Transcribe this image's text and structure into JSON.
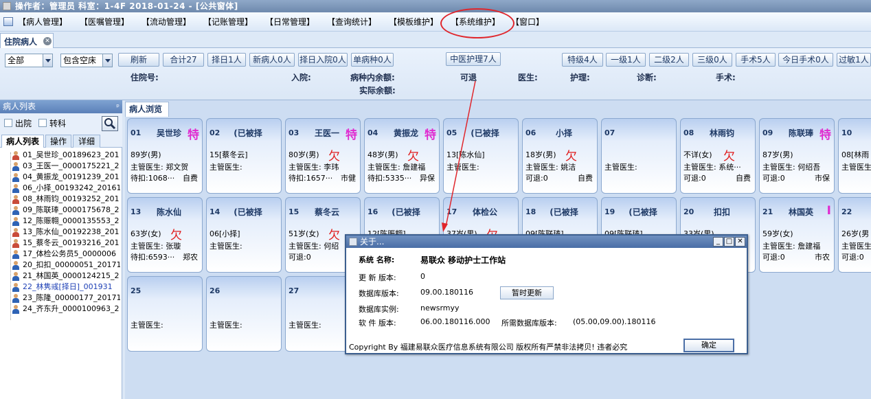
{
  "window": {
    "title": "操作者：管理员   科室：1-4F   2018-01-24 - [公共窗体]"
  },
  "menu": {
    "items": [
      "【病人管理】",
      "【医嘱管理】",
      "【流动管理】",
      "【记账管理】",
      "【日常管理】",
      "【查询统计】",
      "【模板维护】",
      "【系统维护】",
      "【窗口】"
    ],
    "highlight_color": "#e0262c"
  },
  "tab": {
    "label": "住院病人"
  },
  "toolbar": {
    "filter_value": "全部",
    "bed_value": "包含空床",
    "buttons": [
      "刷新",
      "合计27",
      "择日1人",
      "新病人0人",
      "择日入院0人",
      "单病种0人"
    ],
    "tcm_button": "中医护理7人",
    "right_buttons": [
      "特级4人",
      "一级1人",
      "二级2人",
      "三级0人",
      "手术5人",
      "今日手术0人",
      "过敏1人"
    ]
  },
  "info": {
    "admission_no": "住院号:",
    "admit": "入院:",
    "disease_balance": "病种内余额:",
    "actual_balance": "实际余额:",
    "refundable": "可退",
    "doctor": "医生:",
    "nursing": "护理:",
    "diagnosis": "诊断:",
    "surgery": "手术:"
  },
  "left_panel": {
    "title": "病人列表",
    "pin": "ᵖ",
    "discharged": "出院",
    "transfer": "转科",
    "tabs": [
      "病人列表",
      "操作",
      "详细"
    ],
    "patients": [
      {
        "text": "01_吴世珍_00189623_201",
        "female": true
      },
      {
        "text": "03_王医一_0000175221_2",
        "female": false
      },
      {
        "text": "04_黄振龙_00191239_201",
        "female": false
      },
      {
        "text": "06_小择_00193242_20161",
        "female": false
      },
      {
        "text": "08_林雨钧_00193252_201",
        "female": true
      },
      {
        "text": "09_陈联琫_0000175678_2",
        "female": false
      },
      {
        "text": "12_陈赈翱_0000135553_2",
        "female": false
      },
      {
        "text": "13_陈水仙_00192238_201",
        "female": true
      },
      {
        "text": "15_蔡冬云_00193216_201",
        "female": true
      },
      {
        "text": "17_体检公务员5_0000006",
        "female": false
      },
      {
        "text": "20_扣扣_00000051_20171",
        "female": false
      },
      {
        "text": "21_林国英_0000124215_2",
        "female": false
      },
      {
        "text": "22_林隽彧[择日]_001931",
        "female": false,
        "highlight": true
      },
      {
        "text": "23_陈隆_00000177_20171",
        "female": false
      },
      {
        "text": "24_齐东升_0000100963_2",
        "female": false
      }
    ]
  },
  "main": {
    "tab_label": "病人浏览",
    "beds": [
      {
        "no": "01",
        "name": "吴世珍",
        "tag": "特",
        "l1": "89岁(男)",
        "qian": "",
        "l2": "主管医生: 郑文贺",
        "l3": "待扣:1068···",
        "ins": "自费"
      },
      {
        "no": "02",
        "name": "(已被择",
        "tag": "",
        "l1": "15[蔡冬云]",
        "qian": "",
        "l2": "主管医生:",
        "l3": "",
        "ins": ""
      },
      {
        "no": "03",
        "name": "王医一",
        "tag": "特",
        "l1": "80岁(男)",
        "qian": "欠",
        "l2": "主管医生: 李玮",
        "l3": "待扣:1657···",
        "ins": "市健"
      },
      {
        "no": "04",
        "name": "黄振龙",
        "tag": "特",
        "l1": "48岁(男)",
        "qian": "欠",
        "l2": "主管医生: 詹建福",
        "l3": "待扣:5335···",
        "ins": "异保"
      },
      {
        "no": "05",
        "name": "(已被择",
        "tag": "",
        "l1": "13[陈水仙]",
        "qian": "",
        "l2": "主管医生:",
        "l3": "",
        "ins": ""
      },
      {
        "no": "06",
        "name": "小择",
        "tag": "",
        "l1": "18岁(男)",
        "qian": "欠",
        "l2": "主管医生: 姚洁",
        "l3": "可退:0",
        "ins": "自费"
      },
      {
        "no": "07",
        "name": "",
        "tag": "",
        "l1": "",
        "qian": "",
        "l2": "主管医生:",
        "l3": "",
        "ins": ""
      },
      {
        "no": "08",
        "name": "林雨钧",
        "tag": "",
        "l1": "不详(女)",
        "qian": "欠",
        "l2": "主管医生: 系统···",
        "l3": "可退:0",
        "ins": "自费"
      },
      {
        "no": "09",
        "name": "陈联琫",
        "tag": "特",
        "l1": "87岁(男)",
        "qian": "",
        "l2": "主管医生: 何绍吾",
        "l3": "可退:0",
        "ins": "市保"
      },
      {
        "no": "10",
        "name": "",
        "tag": "",
        "l1": "08[林雨",
        "qian": "",
        "l2": "主管医生",
        "l3": "",
        "ins": ""
      },
      {
        "no": "13",
        "name": "陈水仙",
        "tag": "",
        "l1": "63岁(女)",
        "qian": "欠",
        "l2": "主管医生: 张璇",
        "l3": "待扣:6593···",
        "ins": "郑农"
      },
      {
        "no": "14",
        "name": "(已被择",
        "tag": "",
        "l1": "06[小择]",
        "qian": "",
        "l2": "主管医生:",
        "l3": "",
        "ins": ""
      },
      {
        "no": "15",
        "name": "蔡冬云",
        "tag": "",
        "l1": "51岁(女)",
        "qian": "欠",
        "l2": "主管医生: 何绍",
        "l3": "可退:0",
        "ins": "自"
      },
      {
        "no": "16",
        "name": "(已被择",
        "tag": "",
        "l1": "12[陈赈翱]",
        "qian": "",
        "l2": "",
        "l3": "",
        "ins": ""
      },
      {
        "no": "17",
        "name": "体检公",
        "tag": "",
        "l1": "37岁(男)",
        "qian": "欠",
        "l2": "",
        "l3": "",
        "ins": ""
      },
      {
        "no": "18",
        "name": "(已被择",
        "tag": "",
        "l1": "09[陈联琫]",
        "qian": "",
        "l2": "",
        "l3": "",
        "ins": ""
      },
      {
        "no": "19",
        "name": "(已被择",
        "tag": "",
        "l1": "09[陈联琫]",
        "qian": "",
        "l2": "",
        "l3": "",
        "ins": ""
      },
      {
        "no": "20",
        "name": "扣扣",
        "tag": "",
        "l1": "33岁(男)",
        "qian": "",
        "l2": "",
        "l3": "",
        "ins": ""
      },
      {
        "no": "21",
        "name": "林国英",
        "tag": "I",
        "l1": "59岁(女)",
        "qian": "",
        "l2": "主管医生: 詹建福",
        "l3": "可退:0",
        "ins": "市农"
      },
      {
        "no": "22",
        "name": "",
        "tag": "",
        "l1": "26岁(男",
        "qian": "",
        "l2": "主管医生",
        "l3": "可退:0",
        "ins": ""
      },
      {
        "no": "25",
        "name": "",
        "tag": "",
        "l1": "",
        "qian": "",
        "l2": "主管医生:",
        "l3": "",
        "ins": ""
      },
      {
        "no": "26",
        "name": "",
        "tag": "",
        "l1": "",
        "qian": "",
        "l2": "主管医生:",
        "l3": "",
        "ins": ""
      },
      {
        "no": "27",
        "name": "",
        "tag": "",
        "l1": "",
        "qian": "",
        "l2": "主管医生:",
        "l3": "",
        "ins": ""
      }
    ]
  },
  "dialog": {
    "title": "关于...",
    "system_name_label": "系统 名称:",
    "system_name": "易联众 移动护士工作站",
    "update_version_label": "更 新 版本:",
    "update_version": "0",
    "db_version_label": "数据库版本:",
    "db_version": "09.00.180116",
    "update_button": "暂时更新",
    "db_instance_label": "数据库实例:",
    "db_instance": "newsrmyy",
    "software_version_label": "软 件 版本:",
    "software_version": "06.00.180116.000",
    "required_db_label": "所需数据库版本:",
    "required_db": "(05.00,09.00).180116",
    "copyright": "Copyright By 福建易联众医疗信息系统有限公司  版权所有严禁非法拷贝! 违者必究",
    "ok_button": "确定",
    "minimize": "_",
    "maximize": "□",
    "close": "✕"
  }
}
